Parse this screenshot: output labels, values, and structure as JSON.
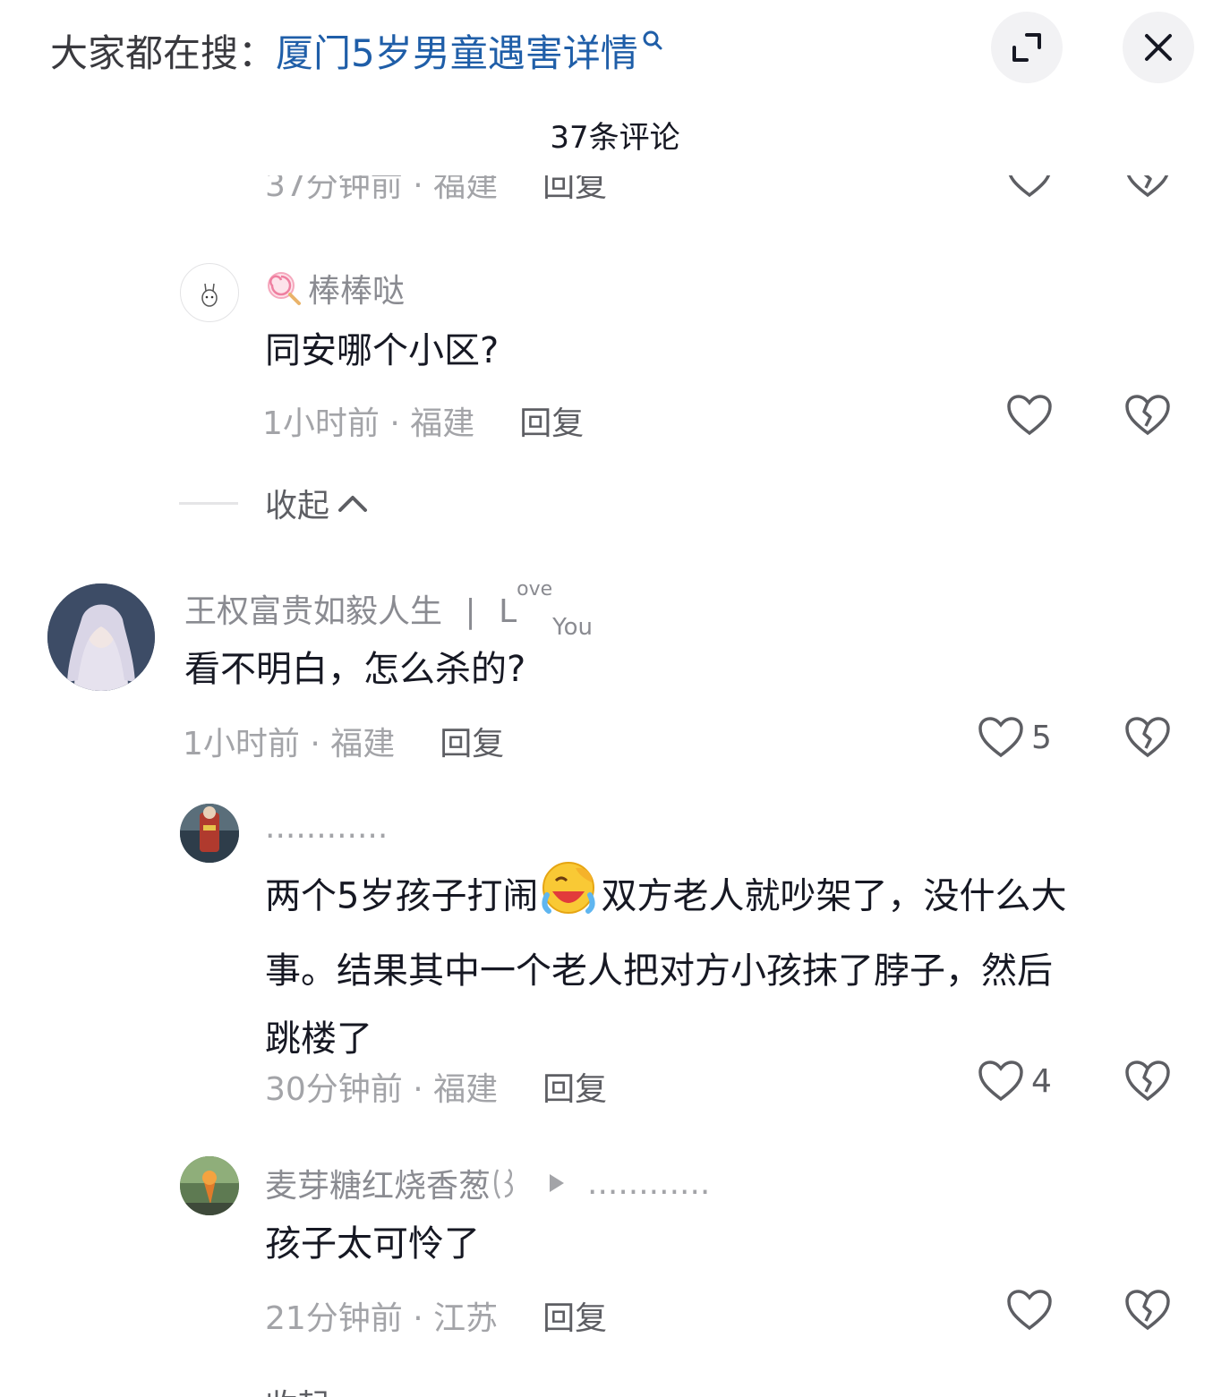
{
  "header": {
    "search_prefix": "大家都在搜：",
    "search_query": "厦门5岁男童遇害详情",
    "comment_count_title": "37条评论"
  },
  "partial_top": {
    "meta_time": "37分钟前 · 福建",
    "reply_label": "回复"
  },
  "comments": [
    {
      "name": "棒棒哒",
      "text": "同安哪个小区?",
      "time_region": "1小时前 · 福建",
      "reply_label": "回复",
      "like_count": ""
    },
    {
      "name": "王权富贵如毅人生",
      "name_suffix_love": "ove",
      "name_suffix_you": "You",
      "name_suffix_l": "L",
      "text": "看不明白，怎么杀的?",
      "time_region": "1小时前 · 福建",
      "reply_label": "回复",
      "like_count": "5"
    },
    {
      "name": "............",
      "text_line1": "两个5岁孩子打闹",
      "text_line1b": "双方老人就吵架了，没什么大",
      "text_line2": "事。结果其中一个老人把对方小孩抹了脖子，然后",
      "text_line3": "跳楼了",
      "time_region": "30分钟前 · 福建",
      "reply_label": "回复",
      "like_count": "4"
    },
    {
      "name": "麦芽糖红烧香葱",
      "reply_to": "............",
      "text": "孩子太可怜了",
      "time_region": "21分钟前 · 江苏",
      "reply_label": "回复",
      "like_count": ""
    }
  ],
  "collapse_label": "收起",
  "icons": {
    "search": "search-icon",
    "expand": "expand-icon",
    "close": "close-icon",
    "like": "heart-outline-icon",
    "dislike": "broken-heart-icon",
    "chevron_up": "chevron-up-icon",
    "play": "play-triangle-icon",
    "emoji": "laughing-crying-emoji-icon",
    "lollipop": "lollipop-emoji-icon"
  },
  "colors": {
    "accent_link": "#1f5ea8",
    "text_primary": "#161823",
    "text_secondary": "#a3a4a8",
    "button_bg": "#f2f2f4"
  }
}
